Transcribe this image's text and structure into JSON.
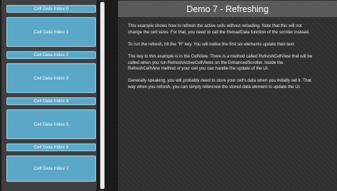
{
  "header": {
    "title": "Demo 7 - Refreshing"
  },
  "scroller": {
    "cells": [
      {
        "label": "Cell Data Index 0",
        "size": "small"
      },
      {
        "label": "Cell Data Index 1",
        "size": "large"
      },
      {
        "label": "Cell Data Index 2",
        "size": "small"
      },
      {
        "label": "Cell Data Index 3",
        "size": "large"
      },
      {
        "label": "Cell Data Index 4",
        "size": "small"
      },
      {
        "label": "Cell Data Index 5",
        "size": "large"
      },
      {
        "label": "Cell Data Index 6",
        "size": "small"
      },
      {
        "label": "Cell Data Index 7",
        "size": "large"
      }
    ],
    "scroll_position": 0.0
  },
  "description": {
    "paragraphs": [
      "This example shows how to refresh the active cells without reloading. Note that this will not\nchange the cell sizes. For that, you need to call the ReloadData function of the scroller instead.",
      "To run the refresh, hit the \"R\" key. You will notice the first six elements update their text.",
      "The key to this example is in the CellView. There is a method called RefreshCellView that will be\ncalled when you run RefreshActiveCellViews on the EnhancedScroller. Inside the\nRefreshCellView method of your cell you can handle the update of the UI.",
      "Generally speaking, you will probably need to store your cell's data when you initially set it. That\nway when you refresh, you can simply reference the stored data element to update the UI."
    ]
  },
  "colors": {
    "cell_fill": "#5aa7c7",
    "cell_border": "#8fcde6",
    "scroller_bg": "#3f3f3f",
    "title_bar_bg": "#5a5a5a",
    "panel_bg": "#2f2f2f",
    "scroll_thumb": "#e8e8e8"
  }
}
